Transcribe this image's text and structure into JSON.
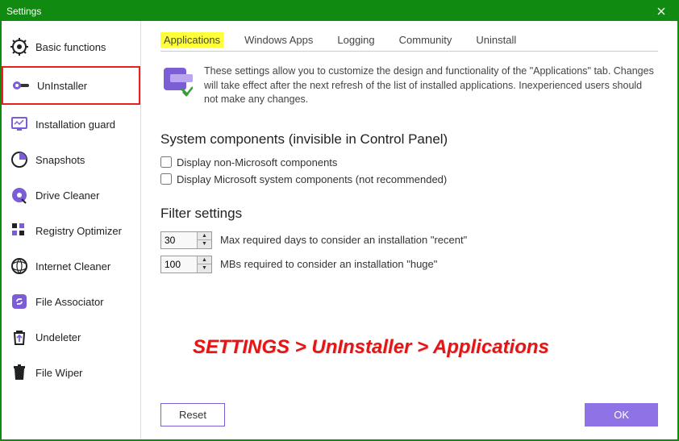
{
  "titlebar": {
    "title": "Settings"
  },
  "sidebar": {
    "items": [
      {
        "label": "Basic functions",
        "icon": "gear-icon"
      },
      {
        "label": "UnInstaller",
        "icon": "uninstaller-icon",
        "highlighted": true
      },
      {
        "label": "Installation guard",
        "icon": "monitor-icon"
      },
      {
        "label": "Snapshots",
        "icon": "circle-icon"
      },
      {
        "label": "Drive Cleaner",
        "icon": "disk-icon"
      },
      {
        "label": "Registry Optimizer",
        "icon": "blocks-icon"
      },
      {
        "label": "Internet Cleaner",
        "icon": "globe-icon"
      },
      {
        "label": "File Associator",
        "icon": "link-icon"
      },
      {
        "label": "Undeleter",
        "icon": "undelete-icon"
      },
      {
        "label": "File Wiper",
        "icon": "trash-icon"
      }
    ]
  },
  "tabs": [
    {
      "label": "Applications",
      "active": true
    },
    {
      "label": "Windows Apps"
    },
    {
      "label": "Logging"
    },
    {
      "label": "Community"
    },
    {
      "label": "Uninstall"
    }
  ],
  "info": {
    "text": "These settings allow you to customize the design and functionality of the \"Applications\" tab. Changes will take effect after the next refresh of the list of installed applications. Inexperienced users should not make any changes."
  },
  "system_components": {
    "heading": "System components (invisible in Control Panel)",
    "check1": "Display non-Microsoft components",
    "check2": "Display Microsoft system components (not recommended)"
  },
  "filter": {
    "heading": "Filter settings",
    "days": {
      "value": "30",
      "label": "Max required days to consider an installation \"recent\""
    },
    "mbs": {
      "value": "100",
      "label": "MBs required to consider an installation \"huge\""
    }
  },
  "annotation": "SETTINGS > UnInstaller > Applications",
  "footer": {
    "reset": "Reset",
    "ok": "OK"
  },
  "colors": {
    "accent": "#8f73e6",
    "green": "#108a10",
    "highlight": "#ffff3a",
    "annotation_red": "#e61515"
  }
}
